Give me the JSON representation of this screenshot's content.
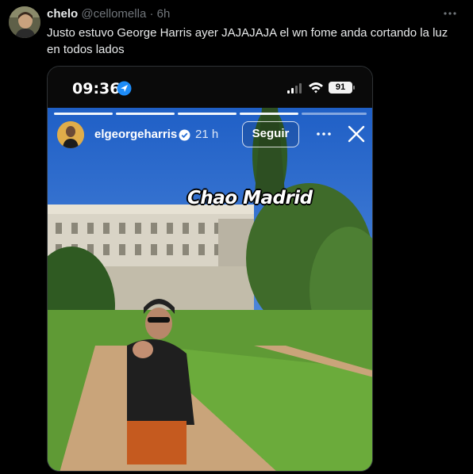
{
  "tweet": {
    "author_name": "chelo",
    "handle": "@cellomella",
    "separator": "·",
    "time": "6h",
    "text": "Justo estuvo George Harris ayer JAJAJAJA el wn fome anda cortando la luz en todos lados",
    "more_icon": "ellipsis-icon"
  },
  "phone_status": {
    "clock": "09:36",
    "battery": "91",
    "icons": [
      "location-arrow-icon",
      "signal-bars-icon",
      "wifi-icon",
      "battery-icon"
    ]
  },
  "story": {
    "username": "elgeorgeharris",
    "time": "21 h",
    "follow_label": "Seguir",
    "caption": "Chao Madrid",
    "progress_segments": 5,
    "progress_done": 4,
    "icons": [
      "verified-badge-icon",
      "ellipsis-icon",
      "close-icon"
    ]
  }
}
